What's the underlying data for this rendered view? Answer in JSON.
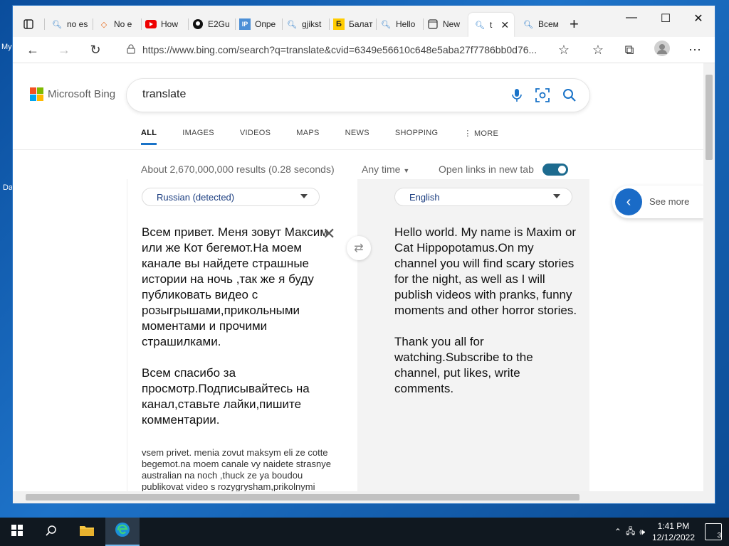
{
  "desktop": {
    "label_1": "My",
    "label_2": "Da"
  },
  "browser": {
    "tabs": [
      {
        "label": "no es",
        "icon": "bing-search-icon"
      },
      {
        "label": "No e",
        "icon": "diamond-icon"
      },
      {
        "label": "How",
        "icon": "youtube-icon"
      },
      {
        "label": "E2Gu",
        "icon": "github-icon"
      },
      {
        "label": "Опре",
        "icon": "ip-icon"
      },
      {
        "label": "gjikst",
        "icon": "bing-search-icon"
      },
      {
        "label": "Балат",
        "icon": "yandex-icon"
      },
      {
        "label": "Hello",
        "icon": "bing-search-icon"
      },
      {
        "label": "New",
        "icon": "new-tab-icon"
      },
      {
        "label": "t",
        "icon": "bing-search-icon",
        "active": true
      },
      {
        "label": "Всем",
        "icon": "bing-search-icon"
      }
    ],
    "url": "https://www.bing.com/search?q=translate&cvid=6349e56610c648e5aba27f7786bb0d76..."
  },
  "bing": {
    "logo_text": "Microsoft Bing",
    "query": "translate",
    "scopes": [
      "ALL",
      "IMAGES",
      "VIDEOS",
      "MAPS",
      "NEWS",
      "SHOPPING",
      "MORE"
    ],
    "results_info": "About 2,670,000,000 results (0.28 seconds)",
    "any_time": "Any time",
    "open_links": "Open links in new tab",
    "see_more": "See more"
  },
  "translator": {
    "source_lang": "Russian (detected)",
    "target_lang": "English",
    "source_text": "Всем привет. Меня зовут Максим или же Кот бегемот.На моем канале вы найдете страшные истории на ночь ,так же я буду публиковать видео с розыгрышами,прикольными моментами и прочими страшилками.\n\nВсем спасибо за просмотр.Подписывайтесь на канал,ставьте лайки,пишите комментарии.",
    "transliteration": "vsem privet. menia zovut maksym eli ze cotte begemot.na moem canale vy naidete strasnye australian na noch ,thuck ze ya boudou publikovat video s rozygrysham,prikolnymi momentami yi",
    "target_text": "Hello world. My name is Maxim or Cat Hippopotamus.On my channel you will find scary stories for the night, as well as I will publish videos with pranks, funny moments and other horror stories.\n\nThank you all for watching.Subscribe to the channel, put likes, write comments."
  },
  "taskbar": {
    "time": "1:41 PM",
    "date": "12/12/2022",
    "notifications": "3"
  },
  "colors": {
    "accent": "#1a73c8",
    "toggle": "#1d6b8f",
    "taskbar": "#101820"
  }
}
